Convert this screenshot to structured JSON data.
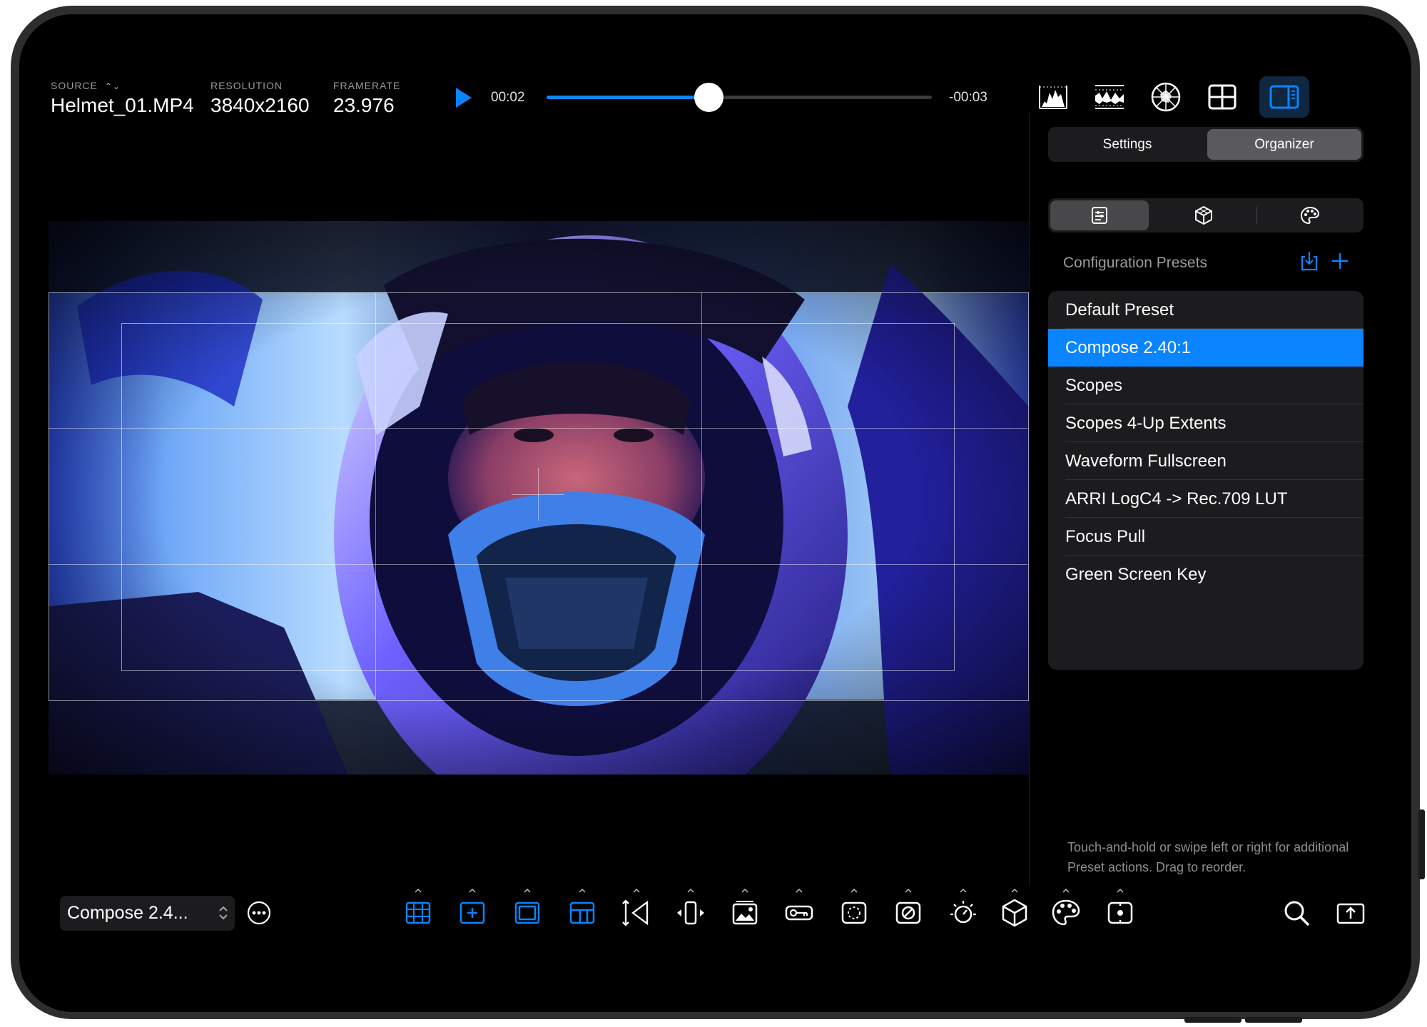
{
  "colors": {
    "accent": "#0a84ff",
    "panel": "#1c1c1e",
    "selected_segment": "#5a5a5e",
    "text_secondary": "#9a9a9e"
  },
  "header": {
    "source": {
      "label": "SOURCE",
      "value": "Helmet_01.MP4"
    },
    "resolution": {
      "label": "RESOLUTION",
      "value": "3840x2160"
    },
    "framerate": {
      "label": "FRAMERATE",
      "value": "23.976"
    }
  },
  "transport": {
    "elapsed": "00:02",
    "remaining": "-00:03",
    "progress_percent": 42
  },
  "top_icons": [
    "histogram-icon",
    "waveform-icon",
    "vectorscope-icon",
    "grid-layout-icon",
    "sidebar-icon"
  ],
  "panel": {
    "tabs": [
      {
        "label": "Settings",
        "selected": false
      },
      {
        "label": "Organizer",
        "selected": true
      }
    ],
    "categories": [
      "configuration-icon",
      "lut-cube-icon",
      "palette-icon"
    ],
    "section_title": "Configuration Presets",
    "presets": [
      {
        "label": "Default Preset",
        "selected": false
      },
      {
        "label": "Compose 2.40:1",
        "selected": true
      },
      {
        "label": "Scopes",
        "selected": false
      },
      {
        "label": "Scopes 4-Up Extents",
        "selected": false
      },
      {
        "label": "Waveform Fullscreen",
        "selected": false
      },
      {
        "label": "ARRI LogC4 -> Rec.709 LUT",
        "selected": false
      },
      {
        "label": "Focus Pull",
        "selected": false
      },
      {
        "label": "Green Screen Key",
        "selected": false
      }
    ],
    "hint": "Touch-and-hold or swipe left or right for additional Preset actions. Drag to reorder."
  },
  "bottom": {
    "current_preset": "Compose 2.4...",
    "tools": [
      {
        "icon": "grid-overlay-icon",
        "active": true
      },
      {
        "icon": "crosshair-icon",
        "active": true
      },
      {
        "icon": "frame-guide-icon",
        "active": true
      },
      {
        "icon": "safe-area-icon",
        "active": true
      },
      {
        "icon": "anamorphic-icon",
        "active": false
      },
      {
        "icon": "flip-icon",
        "active": false
      },
      {
        "icon": "image-overlay-icon",
        "active": false
      },
      {
        "icon": "key-icon",
        "active": false
      },
      {
        "icon": "false-color-icon",
        "active": false
      },
      {
        "icon": "zebra-icon",
        "active": false
      },
      {
        "icon": "exposure-icon",
        "active": false
      },
      {
        "icon": "lut-icon",
        "active": false
      },
      {
        "icon": "color-icon",
        "active": false
      },
      {
        "icon": "focus-assist-icon",
        "active": false
      }
    ],
    "right_icons": [
      "search-icon",
      "export-icon"
    ]
  }
}
